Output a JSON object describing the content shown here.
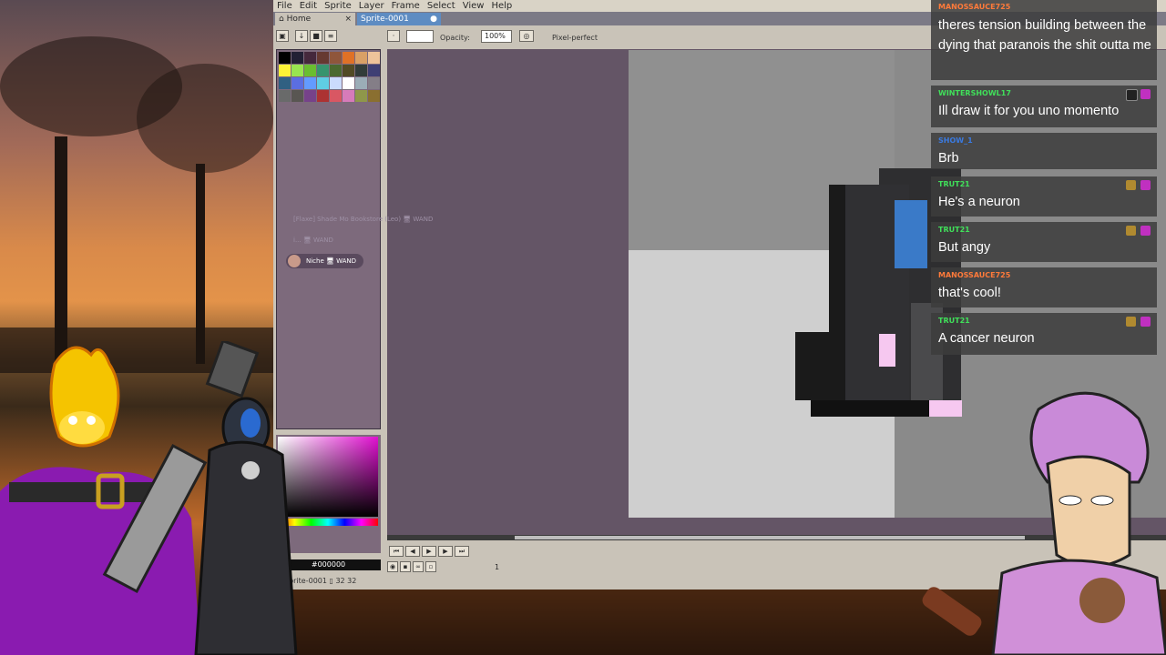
{
  "app": {
    "menu": [
      "File",
      "Edit",
      "Sprite",
      "Layer",
      "Frame",
      "Select",
      "View",
      "Help"
    ],
    "tabs": [
      {
        "label": "Home",
        "close": "×"
      },
      {
        "label": "Sprite-0001",
        "close": "●"
      }
    ],
    "toolbar": {
      "opacity_label": "Opacity:",
      "opacity_value": "100%",
      "pixel_perfect": "Pixel-perfect"
    },
    "color_hex": "#000000",
    "status": "Sprite-0001   ▯ 32 32",
    "frame": "1"
  },
  "faint_overlay": [
    "[Flaxe] Shade Mo Bookstore (Leo) 🖥 WAND",
    "i... 🖥 WAND"
  ],
  "niche_pill": "Niche 🖥 WAND",
  "chat": [
    {
      "user": "MANOSSAUCE725",
      "user_color": "#ff7a3a",
      "text": "theres tension building between the dying that paranois the shit outta me",
      "badge": false
    },
    {
      "user": "WINTERSHOWL17",
      "user_color": "#40e05a",
      "text": "Ill draw it for you uno momento",
      "badge": true
    },
    {
      "user": "SHOW_1",
      "user_color": "#3a7ae0",
      "text": "Brb",
      "badge": false
    },
    {
      "user": "TRUT21",
      "user_color": "#40e05a",
      "text": "He's a neuron",
      "badge": true
    },
    {
      "user": "TRUT21",
      "user_color": "#40e05a",
      "text": "But angy",
      "badge": true
    },
    {
      "user": "MANOSSAUCE725",
      "user_color": "#ff7a3a",
      "text": "that's cool!",
      "badge": false
    },
    {
      "user": "TRUT21",
      "user_color": "#40e05a",
      "text": "A cancer neuron",
      "badge": true
    }
  ],
  "colors": {
    "accent": "#5e8cc2",
    "panel": "#7d6a7c",
    "canvas": "#645566"
  }
}
